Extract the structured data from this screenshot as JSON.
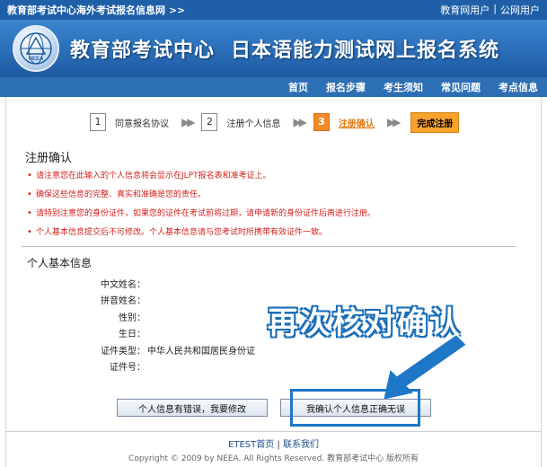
{
  "topbar": {
    "site_name": "教育部考试中心海外考试报名信息网 >>",
    "link_user": "教育网用户",
    "separator": "|",
    "link_public": "公网用户"
  },
  "banner": {
    "logo_text": "NEEA",
    "title_main": "教育部考试中心",
    "title_sub": "日本语能力测试网上报名系统"
  },
  "nav": {
    "items": [
      "首页",
      "报名步骤",
      "考生须知",
      "常见问题",
      "考点信息"
    ]
  },
  "steps": [
    {
      "num": "1",
      "label": "同意报名协议",
      "active": false
    },
    {
      "num": "2",
      "label": "注册个人信息",
      "active": false
    },
    {
      "num": "3",
      "label": "注册确认",
      "active": true
    }
  ],
  "step_final": "完成注册",
  "confirm_heading": "注册确认",
  "notes": [
    "请注意您在此输入的个人信息将会显示在JLPT报名表和准考证上。",
    "确保这些信息的完整、真实和准确是您的责任。",
    "请特别注意您的身份证件，如果您的证件在考试前将过期，请申请新的身份证件后再进行注册。",
    "个人基本信息提交后不可修改。个人基本信息请与您考试时所携带有效证件一致。"
  ],
  "info_heading": "个人基本信息",
  "fields": [
    {
      "label": "中文姓名：",
      "value": ""
    },
    {
      "label": "拼音姓名：",
      "value": ""
    },
    {
      "label": "性别：",
      "value": ""
    },
    {
      "label": "生日：",
      "value": ""
    },
    {
      "label": "证件类型：",
      "value": "中华人民共和国居民身份证"
    },
    {
      "label": "证件号：",
      "value": ""
    }
  ],
  "overlay_text": "再次核对确认",
  "buttons": {
    "edit": "个人信息有错误，我要修改",
    "confirm": "我确认个人信息正确无误"
  },
  "footer": {
    "link_etest": "ETEST首页",
    "separator": "|",
    "link_contact": "联系我们",
    "copyright": "Copyright © 2009 by NEEA. All Rights Reserved. 教育部考试中心 版权所有"
  },
  "colors": {
    "brand_blue": "#1f5fa8",
    "accent_orange": "#f08a2b",
    "note_red": "#d3211d",
    "highlight_blue": "#1f77c8"
  }
}
